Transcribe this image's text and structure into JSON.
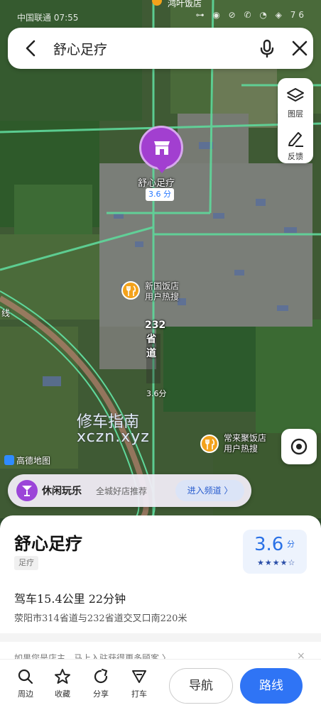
{
  "status_bar": {
    "carrier": "中国联通 07:55",
    "icons": "⊶ ◉ ⊘ ✆ ◔ ◈ 76",
    "top_poi": "鸿叶饭店"
  },
  "search": {
    "query": "舒心足疗",
    "back_icon": "arrow-left-icon",
    "mic_icon": "microphone-icon",
    "close_icon": "close-icon"
  },
  "tools": {
    "layers_label": "图层",
    "feedback_label": "反馈"
  },
  "map": {
    "poi_name": "舒心足疗",
    "poi_rating": "3.6 分",
    "food1_name": "新国饭店",
    "food1_sub": "用户热搜",
    "food2_name": "常来聚饭店",
    "food2_sub": "用户热搜",
    "road_label": "232省道",
    "road_time": "3.6分",
    "watermark_line1": "修车指南",
    "watermark_line2": "xczn.xyz",
    "logo": "高德地图",
    "side_label": "线"
  },
  "banner": {
    "title": "休闲玩乐",
    "subtitle": "全城好店推荐",
    "button": "进入频道 〉"
  },
  "place": {
    "name": "舒心足疗",
    "tag": "足疗",
    "score": "3.6",
    "score_unit": "分",
    "stars": "★★★★☆",
    "drive_info": "驾车15.4公里 22分钟",
    "address": "荥阳市314省道与232省道交叉口南220米"
  },
  "owner_notice": {
    "text": "如果您是店主，马上入驻获得更多顾客 〉",
    "close": "×"
  },
  "actions": {
    "nearby": "周边",
    "favorite": "收藏",
    "share": "分享",
    "taxi": "打车",
    "navigate": "导航",
    "route": "路线"
  },
  "colors": {
    "poi_purple": "#a23fd0",
    "food_orange": "#f3a21b",
    "primary_blue": "#2f74f5",
    "road_green": "#5fd89b"
  }
}
